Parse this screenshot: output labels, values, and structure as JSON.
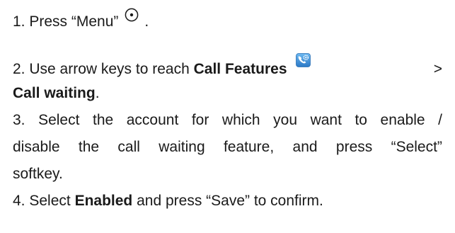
{
  "steps": {
    "s1": {
      "text": "1. Press “Menu”",
      "end": "."
    },
    "s2": {
      "prefix": "2. Use arrow keys to reach",
      "bold1": "Call Features",
      "sep": ">",
      "bold2": "Call waiting",
      "end": "."
    },
    "s3": {
      "line1": [
        "3.",
        "Select",
        "the",
        "account",
        "for",
        "which",
        "you",
        "want",
        "to",
        "enable",
        "/"
      ],
      "line2": [
        "disable",
        "the",
        "call",
        "waiting",
        "feature,",
        "and",
        "press",
        "“Select”"
      ],
      "line3": "softkey."
    },
    "s4": {
      "prefix": "4. Select",
      "bold": "Enabled",
      "rest": "and press “Save” to confirm."
    }
  },
  "icons": {
    "menu": "circle-dot-icon",
    "call_features": "phone-gear-icon"
  },
  "colors": {
    "text": "#1a1a1a",
    "icon_blue": "#3c8ed6"
  }
}
